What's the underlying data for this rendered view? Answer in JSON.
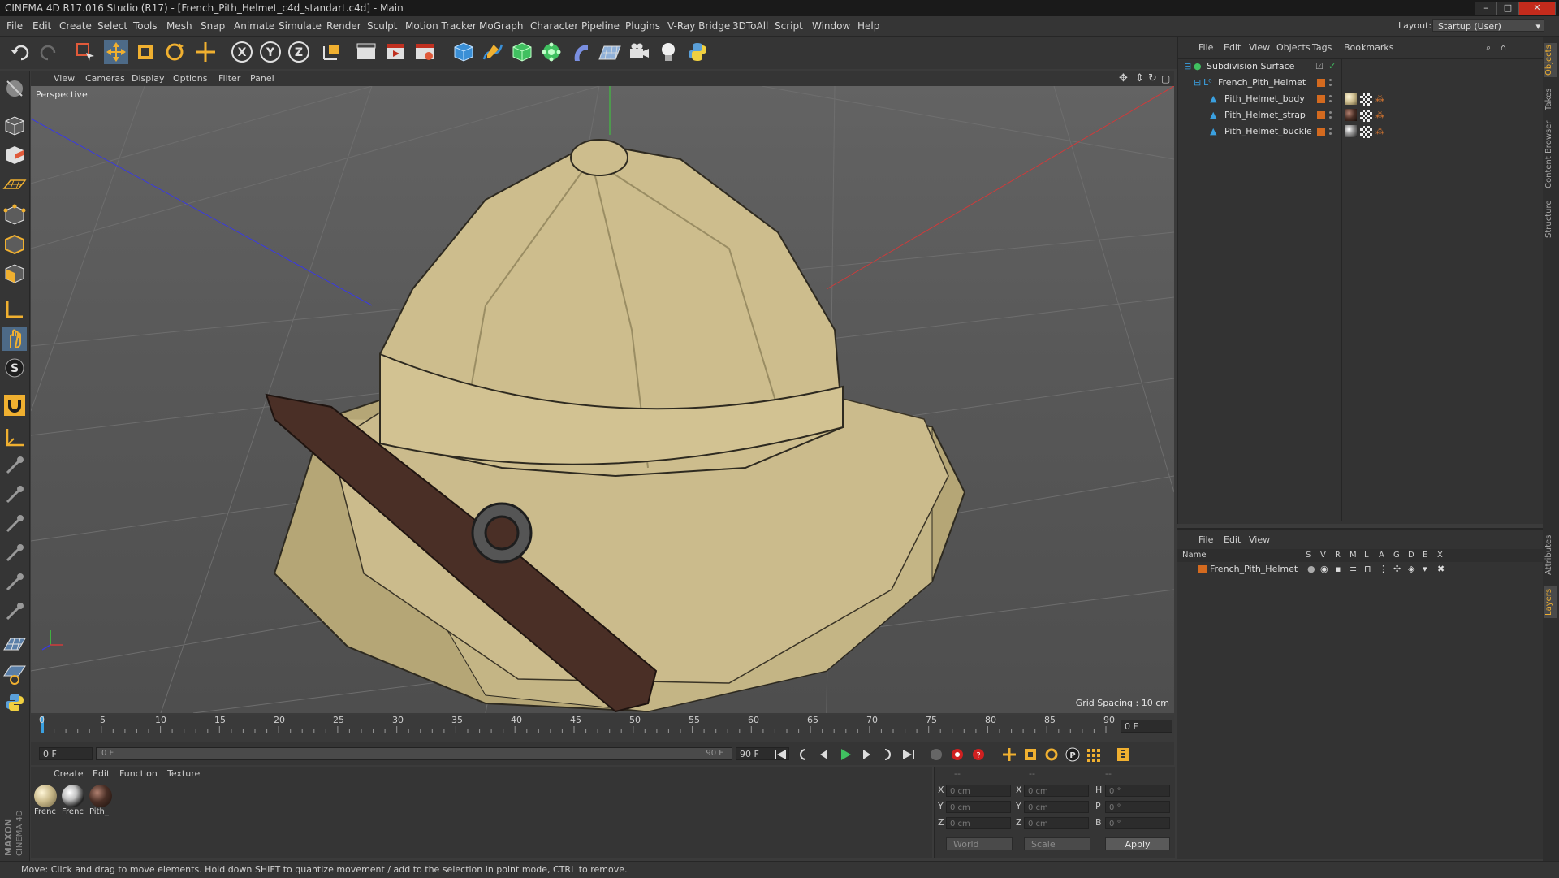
{
  "window": {
    "title": "CINEMA 4D R17.016 Studio (R17) - [French_Pith_Helmet_c4d_standart.c4d] - Main"
  },
  "menu": {
    "items": [
      "File",
      "Edit",
      "Create",
      "Select",
      "Tools",
      "Mesh",
      "Snap",
      "Animate",
      "Simulate",
      "Render",
      "Sculpt",
      "Motion Tracker",
      "MoGraph",
      "Character",
      "Pipeline",
      "Plugins",
      "V-Ray Bridge",
      "3DToAll",
      "Script",
      "Window",
      "Help"
    ],
    "layout_label": "Layout:",
    "layout_value": "Startup (User)"
  },
  "viewport": {
    "menu": [
      "View",
      "Cameras",
      "Display",
      "Options",
      "Filter",
      "Panel"
    ],
    "camera_label": "Perspective",
    "grid_spacing": "Grid Spacing : 10 cm"
  },
  "timeline": {
    "ticks": [
      "0",
      "5",
      "10",
      "15",
      "20",
      "25",
      "30",
      "35",
      "40",
      "45",
      "50",
      "55",
      "60",
      "65",
      "70",
      "75",
      "80",
      "85",
      "90"
    ],
    "current_frame": "0 F"
  },
  "animation": {
    "start_field": "0 F",
    "range_start": "0 F",
    "range_end": "90 F",
    "end_field": "90 F"
  },
  "materials": {
    "menu": [
      "Create",
      "Edit",
      "Function",
      "Texture"
    ],
    "items": [
      {
        "label": "Frenc",
        "color": "#c9b98a"
      },
      {
        "label": "Frenc",
        "color": "#bfbfbf"
      },
      {
        "label": "Pith_",
        "color": "#4a2f26"
      }
    ]
  },
  "coordinates": {
    "headers": [
      "--",
      "--",
      "--"
    ],
    "rows": [
      {
        "a": "X",
        "a_val": "0 cm",
        "b": "X",
        "b_val": "0 cm",
        "c": "H",
        "c_val": "0 °"
      },
      {
        "a": "Y",
        "a_val": "0 cm",
        "b": "Y",
        "b_val": "0 cm",
        "c": "P",
        "c_val": "0 °"
      },
      {
        "a": "Z",
        "a_val": "0 cm",
        "b": "Z",
        "b_val": "0 cm",
        "c": "B",
        "c_val": "0 °"
      }
    ],
    "world": "World",
    "scale": "Scale",
    "apply": "Apply"
  },
  "object_manager": {
    "menu": [
      "File",
      "Edit",
      "View",
      "Objects",
      "Tags",
      "Bookmarks"
    ],
    "objects": [
      "Subdivision Surface",
      "French_Pith_Helmet",
      "Pith_Helmet_body",
      "Pith_Helmet_strap",
      "Pith_Helmet_buckle"
    ]
  },
  "layer_manager": {
    "menu": [
      "File",
      "Edit",
      "View"
    ],
    "columns": [
      "Name",
      "S",
      "V",
      "R",
      "M",
      "L",
      "A",
      "G",
      "D",
      "E",
      "X"
    ],
    "layers": [
      {
        "name": "French_Pith_Helmet",
        "color": "#d46a1f"
      }
    ]
  },
  "side_tabs": [
    "Objects",
    "Takes",
    "Content Browser",
    "Structure",
    "Attributes",
    "Layers"
  ],
  "status": "Move: Click and drag to move elements. Hold down SHIFT to quantize movement / add to the selection in point mode, CTRL to remove.",
  "brand": {
    "line1": "MAXON",
    "line2": "CINEMA 4D"
  },
  "colors": {
    "accent_orange": "#d46a1f",
    "accent_blue": "#3a8fd6",
    "helmet": "#c9b98a",
    "strap": "#4a2f26"
  }
}
